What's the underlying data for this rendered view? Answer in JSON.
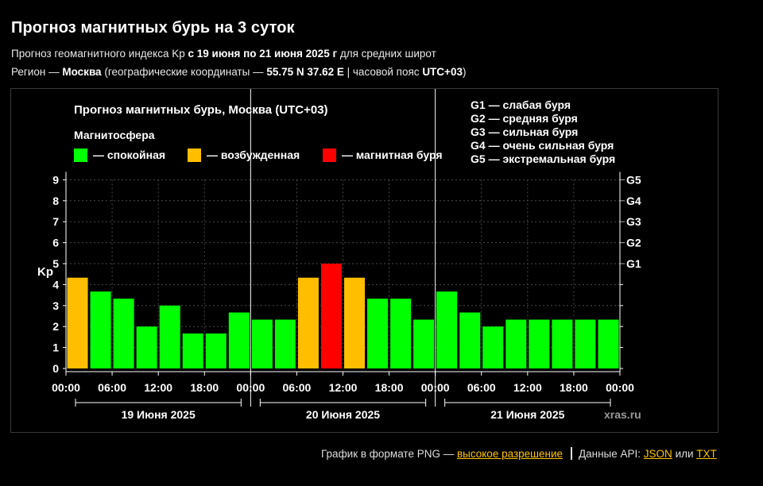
{
  "header": {
    "title": "Прогноз магнитных бурь на 3 суток",
    "line1_pre": "Прогноз геомагнитного индекса Kp ",
    "line1_bold": "с 19 июня по 21 июня 2025 г",
    "line1_post": " для средних широт",
    "line2_pre": "Регион — ",
    "line2_region": "Москва",
    "line2_mid": " (географические координаты — ",
    "line2_coords": "55.75 N 37.62 E",
    "line2_sep": " | часовой пояс ",
    "line2_tz": "UTC+03",
    "line2_post": ")"
  },
  "footer": {
    "png_text": "График в формате PNG — ",
    "png_link": "высокое разрешение",
    "api_text": "Данные API: ",
    "json_link": "JSON",
    "or_text": " или ",
    "txt_link": "TXT"
  },
  "chart_data": {
    "type": "bar",
    "title": "Прогноз магнитных бурь, Москва (UTC+03)",
    "legend_title": "Магнитосфера",
    "ylabel": "Kp",
    "ylim": [
      0,
      9
    ],
    "yticks": [
      "0",
      "1",
      "2",
      "3",
      "4",
      "5",
      "6",
      "7",
      "8",
      "9"
    ],
    "right_ticks": [
      {
        "kp": 5,
        "label": "G1"
      },
      {
        "kp": 6,
        "label": "G2"
      },
      {
        "kp": 7,
        "label": "G3"
      },
      {
        "kp": 8,
        "label": "G4"
      },
      {
        "kp": 9,
        "label": "G5"
      }
    ],
    "storm_levels": [
      "G1 — слабая буря",
      "G2 — средняя буря",
      "G3 — сильная буря",
      "G4 — очень сильная буря",
      "G5 — экстремальная буря"
    ],
    "legend": [
      {
        "label": "— спокойная",
        "color": "#00ff00"
      },
      {
        "label": "— возбужденная",
        "color": "#ffbf00"
      },
      {
        "label": "— магнитная буря",
        "color": "#ff0000"
      }
    ],
    "xticks": [
      "00:00",
      "06:00",
      "12:00",
      "18:00",
      "00:00",
      "06:00",
      "12:00",
      "18:00",
      "00:00",
      "06:00",
      "12:00",
      "18:00",
      "00:00"
    ],
    "days": [
      "19 Июня 2025",
      "20 Июня 2025",
      "21 Июня 2025"
    ],
    "values": [
      4.33,
      3.67,
      3.33,
      2.0,
      3.0,
      1.67,
      1.67,
      2.67,
      2.33,
      2.33,
      4.33,
      5.0,
      4.33,
      3.33,
      3.33,
      2.33,
      3.67,
      2.67,
      2.0,
      2.33,
      2.33,
      2.33,
      2.33,
      2.33
    ],
    "colors": [
      "#ffbf00",
      "#00ff00",
      "#00ff00",
      "#00ff00",
      "#00ff00",
      "#00ff00",
      "#00ff00",
      "#00ff00",
      "#00ff00",
      "#00ff00",
      "#ffbf00",
      "#ff0000",
      "#ffbf00",
      "#00ff00",
      "#00ff00",
      "#00ff00",
      "#00ff00",
      "#00ff00",
      "#00ff00",
      "#00ff00",
      "#00ff00",
      "#00ff00",
      "#00ff00",
      "#00ff00"
    ],
    "watermark": "xras.ru",
    "grid": "dashed"
  }
}
